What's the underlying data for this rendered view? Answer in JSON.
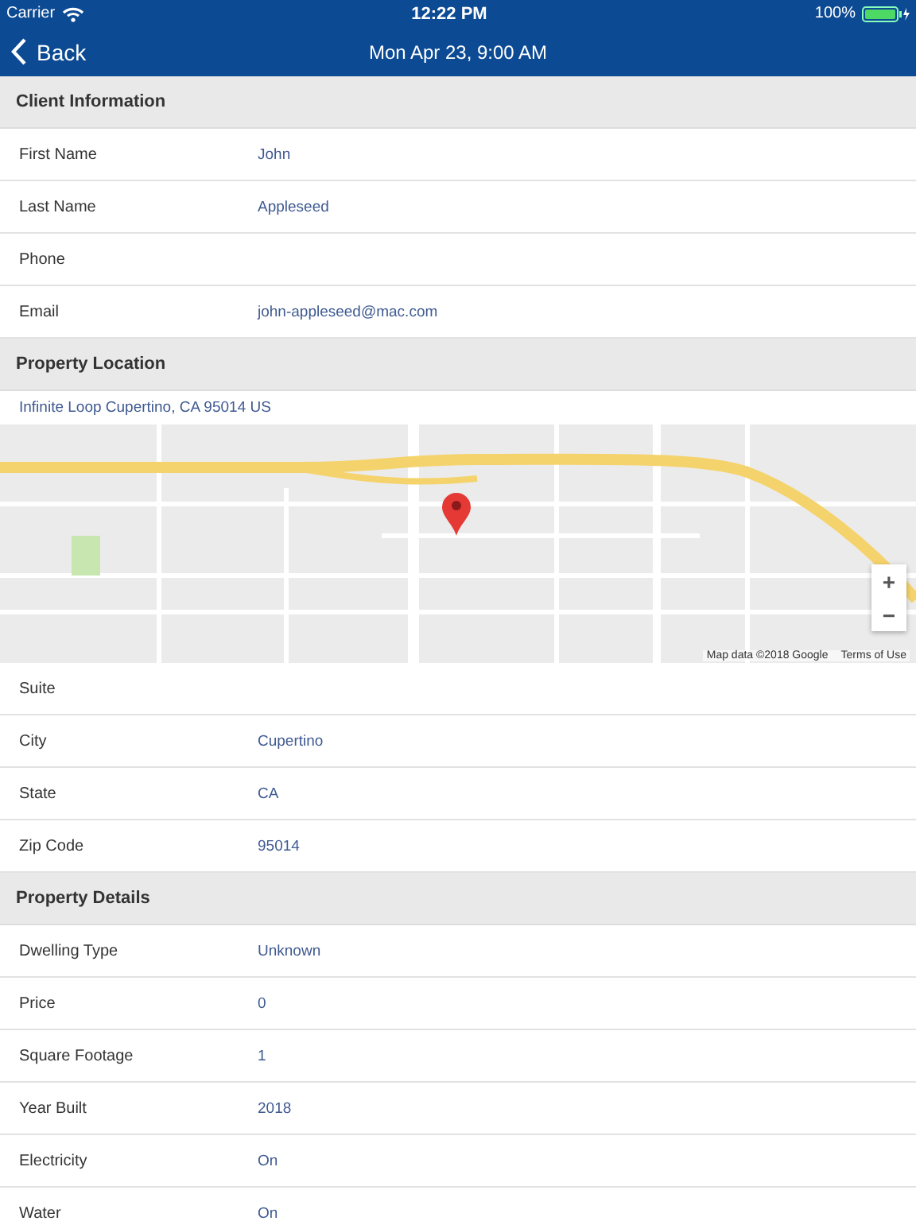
{
  "status_bar": {
    "carrier": "Carrier",
    "time": "12:22 PM",
    "battery": "100%"
  },
  "nav": {
    "back": "Back",
    "title": "Mon Apr 23, 9:00 AM"
  },
  "sections": [
    {
      "title": "Client Information",
      "items": [
        {
          "kind": "field",
          "label": "First Name",
          "value": "John"
        },
        {
          "kind": "field",
          "label": "Last Name",
          "value": "Appleseed"
        },
        {
          "kind": "field",
          "label": "Phone"
        },
        {
          "kind": "field",
          "label": "Email",
          "value": "john-appleseed@mac.com"
        }
      ]
    },
    {
      "title": "Property Location",
      "items": [
        {
          "kind": "address",
          "value": "Infinite Loop Cupertino, CA 95014 US"
        },
        {
          "kind": "map",
          "attribution": "Map data ©2018 Google",
          "terms": "Terms of Use",
          "zoom_in": "+",
          "zoom_out": "−"
        },
        {
          "kind": "field",
          "label": "Suite"
        },
        {
          "kind": "field",
          "label": "City",
          "value": "Cupertino"
        },
        {
          "kind": "field",
          "label": "State",
          "value": "CA"
        },
        {
          "kind": "field",
          "label": "Zip Code",
          "value": "95014"
        }
      ]
    },
    {
      "title": "Property Details",
      "items": [
        {
          "kind": "field",
          "label": "Dwelling Type",
          "value": "Unknown"
        },
        {
          "kind": "field",
          "label": "Price",
          "value": "0"
        },
        {
          "kind": "field",
          "label": "Square Footage",
          "value": "1"
        },
        {
          "kind": "field",
          "label": "Year Built",
          "value": "2018"
        },
        {
          "kind": "field",
          "label": "Electricity",
          "value": "On"
        },
        {
          "kind": "field",
          "label": "Water",
          "value": "On"
        }
      ]
    }
  ]
}
